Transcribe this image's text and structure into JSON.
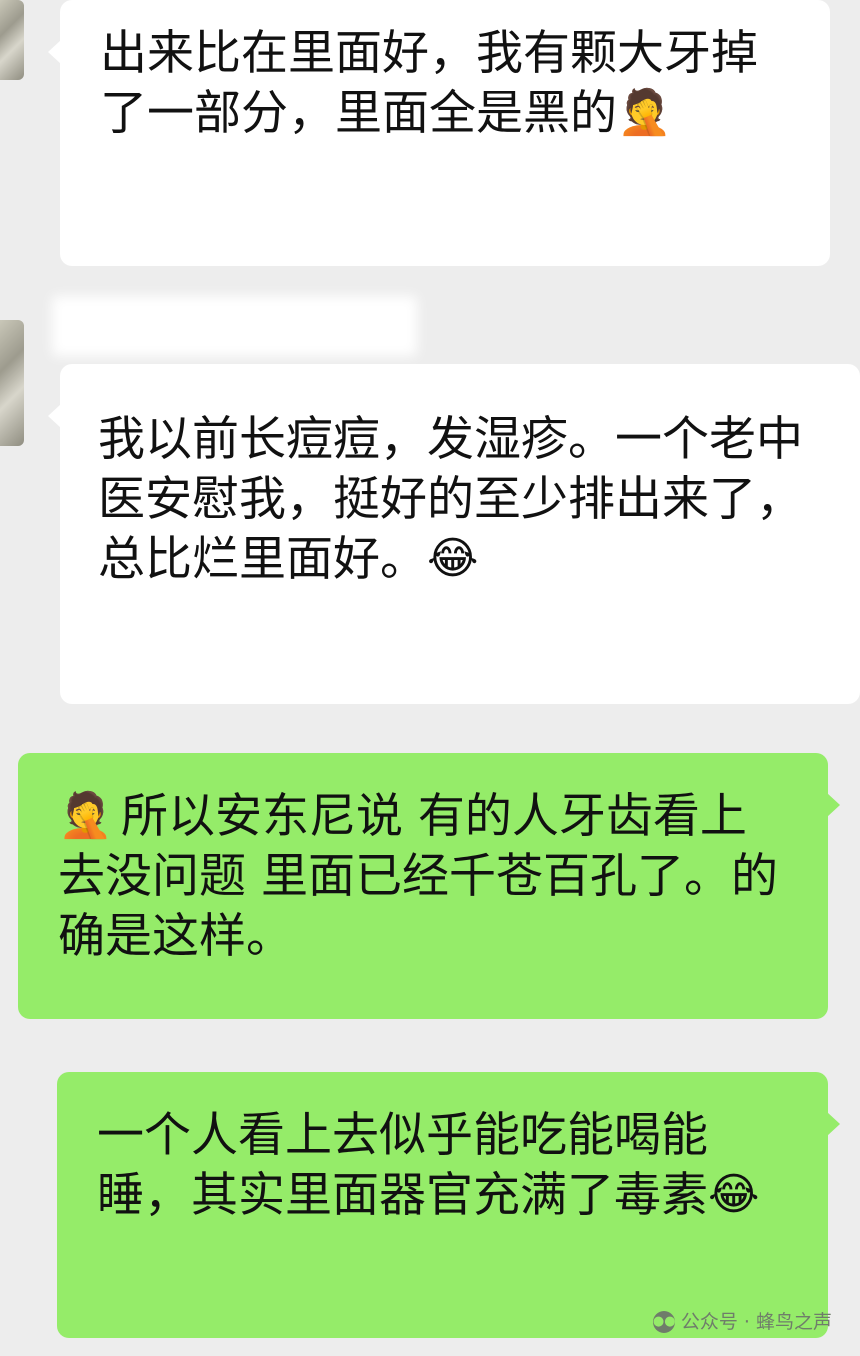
{
  "messages": [
    {
      "side": "in",
      "text": "出来比在里面好，我有颗大牙掉了一部分，里面全是黑的",
      "emoji": "facepalm-emoji",
      "emoji_char": "🤦"
    },
    {
      "side": "in",
      "text": "我以前长痘痘，发湿疹。一个老中医安慰我，挺好的至少排出来了，总比烂里面好。",
      "emoji": "tears-of-joy-emoji",
      "emoji_char": "😂"
    },
    {
      "side": "out",
      "emoji": "facepalm-emoji",
      "emoji_char": "🤦",
      "text": " 所以安东尼说 有的人牙齿看上去没问题 里面已经千苍百孔了。的确是这样。"
    },
    {
      "side": "out",
      "text": "一个人看上去似乎能吃能喝能睡，其实里面器官充满了毒素",
      "emoji": "tears-of-joy-emoji",
      "emoji_char": "😂"
    }
  ],
  "watermark": {
    "text": "公众号 · 蜂鸟之声",
    "icon": "wechat-icon"
  },
  "colors": {
    "background": "#ededed",
    "incoming_bubble": "#ffffff",
    "outgoing_bubble": "#95ec69"
  }
}
